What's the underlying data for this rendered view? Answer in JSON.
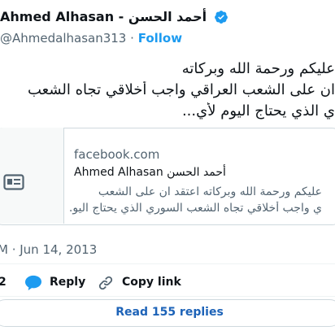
{
  "author": {
    "display_name": "Ahmed Alhasan - أحمد الحسن",
    "handle": "@Ahmedalhasan313",
    "separator": "·",
    "follow_label": "Follow"
  },
  "tweet": {
    "lines": [
      "عليكم ورحمة الله وبركاته",
      "ان على الشعب العراقي واجب أخلاقي تجاه الشعب",
      "ي الذي يحتاج اليوم لأي..."
    ]
  },
  "card": {
    "domain": "facebook.com",
    "title": "Ahmed Alhasan أحمد الحسن",
    "desc_lines": [
      "عليكم ورحمة الله وبركاته اعتقد ان على الشعب",
      "ي واجب أخلاقي تجاه الشعب السوري الذي يحتاج اليو..."
    ]
  },
  "timestamp": "M · Jun 14, 2013",
  "actions": {
    "likes_count": "2",
    "reply_label": "Reply",
    "copy_label": "Copy link"
  },
  "read_replies_label": "Read 155 replies",
  "colors": {
    "accent": "#1d9bf0",
    "link_button_text": "#1d63b8",
    "secondary_text": "#536471",
    "border": "#cfd9de"
  },
  "icons": [
    "verified-badge-icon",
    "article-card-icon",
    "reply-icon",
    "copy-link-icon"
  ]
}
